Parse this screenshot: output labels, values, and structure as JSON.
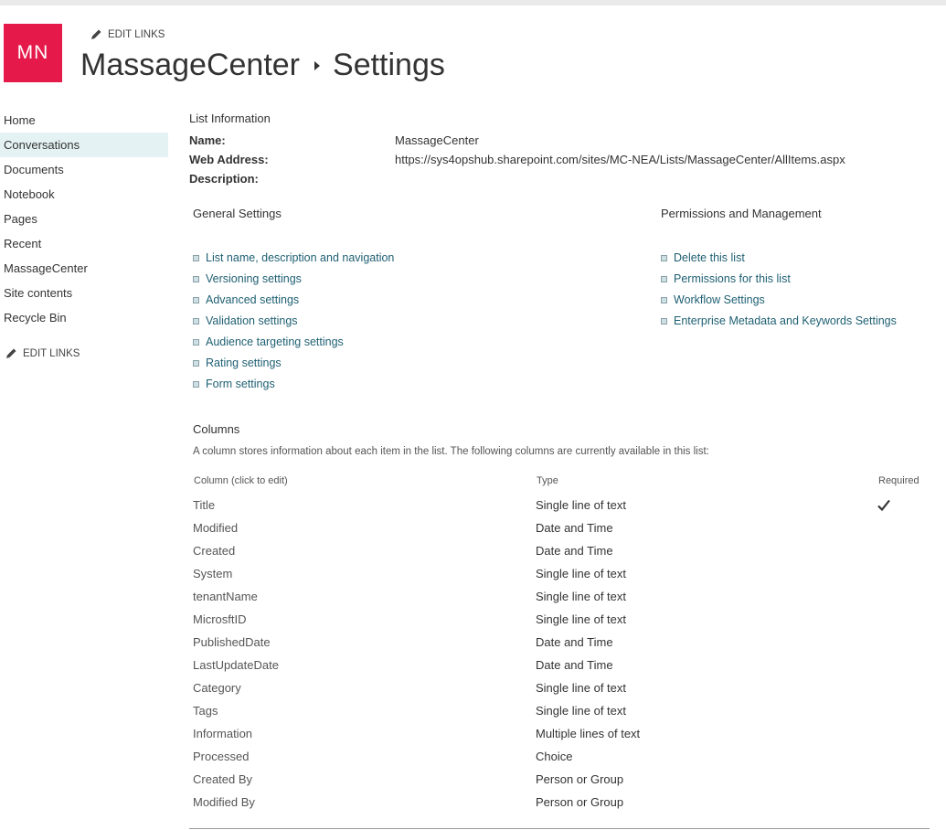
{
  "site": {
    "logo_text": "MN",
    "logo_color": "#e51a4b",
    "edit_links_label": "EDIT LINKS",
    "site_name": "MassageCenter",
    "page_name": "Settings"
  },
  "nav": {
    "items": [
      {
        "label": "Home"
      },
      {
        "label": "Conversations",
        "selected": true
      },
      {
        "label": "Documents"
      },
      {
        "label": "Notebook"
      },
      {
        "label": "Pages"
      },
      {
        "label": "Recent"
      },
      {
        "label": "MassageCenter"
      },
      {
        "label": "Site contents"
      },
      {
        "label": "Recycle Bin"
      }
    ],
    "edit_links_label": "EDIT LINKS"
  },
  "list_info": {
    "heading": "List Information",
    "name_label": "Name:",
    "name_value": "MassageCenter",
    "address_label": "Web Address:",
    "address_value": "https://sys4opshub.sharepoint.com/sites/MC-NEA/Lists/MassageCenter/AllItems.aspx",
    "description_label": "Description:"
  },
  "general_settings": {
    "heading": "General Settings",
    "links": [
      "List name, description and navigation",
      "Versioning settings",
      "Advanced settings",
      "Validation settings",
      "Audience targeting settings",
      "Rating settings",
      "Form settings"
    ]
  },
  "permissions": {
    "heading": "Permissions and Management",
    "links": [
      "Delete this list",
      "Permissions for this list",
      "Workflow Settings",
      "Enterprise Metadata and Keywords Settings"
    ]
  },
  "columns": {
    "heading": "Columns",
    "description": "A column stores information about each item in the list. The following columns are currently available in this list:",
    "headers": {
      "column": "Column (click to edit)",
      "type": "Type",
      "required": "Required"
    },
    "rows": [
      {
        "name": "Title",
        "type": "Single line of text",
        "required": true
      },
      {
        "name": "Modified",
        "type": "Date and Time",
        "required": false
      },
      {
        "name": "Created",
        "type": "Date and Time",
        "required": false
      },
      {
        "name": "System",
        "type": "Single line of text",
        "required": false
      },
      {
        "name": "tenantName",
        "type": "Single line of text",
        "required": false
      },
      {
        "name": "MicrosftID",
        "type": "Single line of text",
        "required": false
      },
      {
        "name": "PublishedDate",
        "type": "Date and Time",
        "required": false
      },
      {
        "name": "LastUpdateDate",
        "type": "Date and Time",
        "required": false
      },
      {
        "name": "Category",
        "type": "Single line of text",
        "required": false
      },
      {
        "name": "Tags",
        "type": "Single line of text",
        "required": false
      },
      {
        "name": "Information",
        "type": "Multiple lines of text",
        "required": false
      },
      {
        "name": "Processed",
        "type": "Choice",
        "required": false
      },
      {
        "name": "Created By",
        "type": "Person or Group",
        "required": false
      },
      {
        "name": "Modified By",
        "type": "Person or Group",
        "required": false
      }
    ]
  },
  "colors": {
    "link": "#1e5f72",
    "nav_selected": "#e4f2f3"
  }
}
